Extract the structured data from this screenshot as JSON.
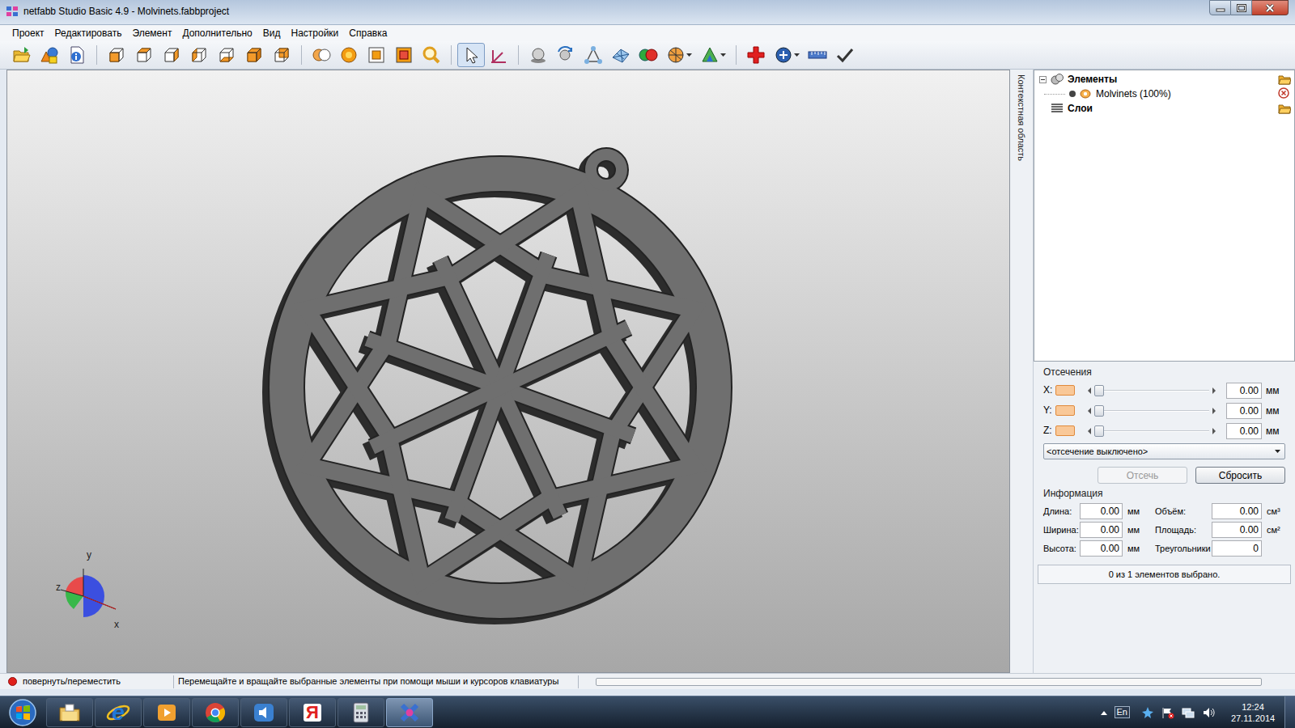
{
  "window": {
    "title": "netfabb Studio Basic 4.9 - Molvinets.fabbproject"
  },
  "menu": [
    "Проект",
    "Редактировать",
    "Элемент",
    "Дополнительно",
    "Вид",
    "Настройки",
    "Справка"
  ],
  "toolbar": [
    [
      {
        "selected": false
      },
      {
        "selected": false
      },
      {
        "selected": false
      }
    ],
    [
      {
        "selected": false
      },
      {
        "selected": false
      },
      {
        "selected": false
      },
      {
        "selected": false
      },
      {
        "selected": false
      },
      {
        "selected": false
      },
      {
        "selected": false
      }
    ],
    [
      {
        "selected": false
      },
      {
        "selected": false
      },
      {
        "selected": false
      },
      {
        "selected": false
      },
      {
        "selected": false
      }
    ],
    [
      {
        "selected": true
      },
      {
        "selected": false
      }
    ],
    [
      {
        "selected": false
      },
      {
        "selected": false
      },
      {
        "selected": false
      },
      {
        "selected": false
      },
      {
        "selected": false
      },
      {
        "selected": false
      },
      {
        "selected": false
      }
    ],
    [
      {
        "selected": false
      },
      {
        "selected": false
      },
      {
        "selected": false
      },
      {
        "selected": false
      }
    ]
  ],
  "viewport": {
    "axes": [
      {
        "label": "y"
      },
      {
        "label": "z"
      },
      {
        "label": "x"
      }
    ]
  },
  "side_tab": "Контекстная область",
  "tree": [
    {
      "label": "Элементы",
      "kind": "group",
      "expanded": true
    },
    {
      "label": "Molvinets (100%)",
      "kind": "part"
    },
    {
      "label": "Слои",
      "kind": "layers"
    }
  ],
  "cuts": {
    "title": "Отсечения",
    "axes": [
      {
        "label": "X:",
        "value": "0.00",
        "unit": "мм",
        "level": 0
      },
      {
        "label": "Y:",
        "value": "0.00",
        "unit": "мм",
        "level": 0
      },
      {
        "label": "Z:",
        "value": "0.00",
        "unit": "мм",
        "level": 0
      }
    ],
    "mode": "<отсечение выключено>",
    "buttons": [
      {
        "label": "Отсечь",
        "disabled": true
      },
      {
        "label": "Сбросить",
        "disabled": false
      }
    ]
  },
  "info": {
    "title": "Информация",
    "fields": [
      {
        "label": "Длина:",
        "value": "0.00",
        "unit": "мм"
      },
      {
        "label": "Объём:",
        "value": "0.00",
        "unit": "см³"
      },
      {
        "label": "Ширина:",
        "value": "0.00",
        "unit": "мм"
      },
      {
        "label": "Площадь:",
        "value": "0.00",
        "unit": "см²"
      },
      {
        "label": "Высота:",
        "value": "0.00",
        "unit": "мм"
      },
      {
        "label": "Треугольники",
        "value": "0"
      }
    ],
    "selection": "0 из 1 элементов выбрано."
  },
  "status_bar": {
    "mode": "повернуть/переместить",
    "hint": "Перемещайте и вращайте выбранные элементы при помощи мыши и курсоров клавиатуры",
    "progress": 0
  },
  "taskbar": {
    "apps": [
      {
        "selected": false
      },
      {
        "glyph": "e",
        "selected": false
      },
      {
        "selected": false
      },
      {
        "selected": false
      },
      {
        "selected": false
      },
      {
        "glyph": "Я",
        "selected": false
      },
      {
        "selected": false
      },
      {
        "selected": true
      }
    ],
    "tray": {
      "language": "En",
      "time": "12:24",
      "date": "27.11.2014"
    }
  }
}
